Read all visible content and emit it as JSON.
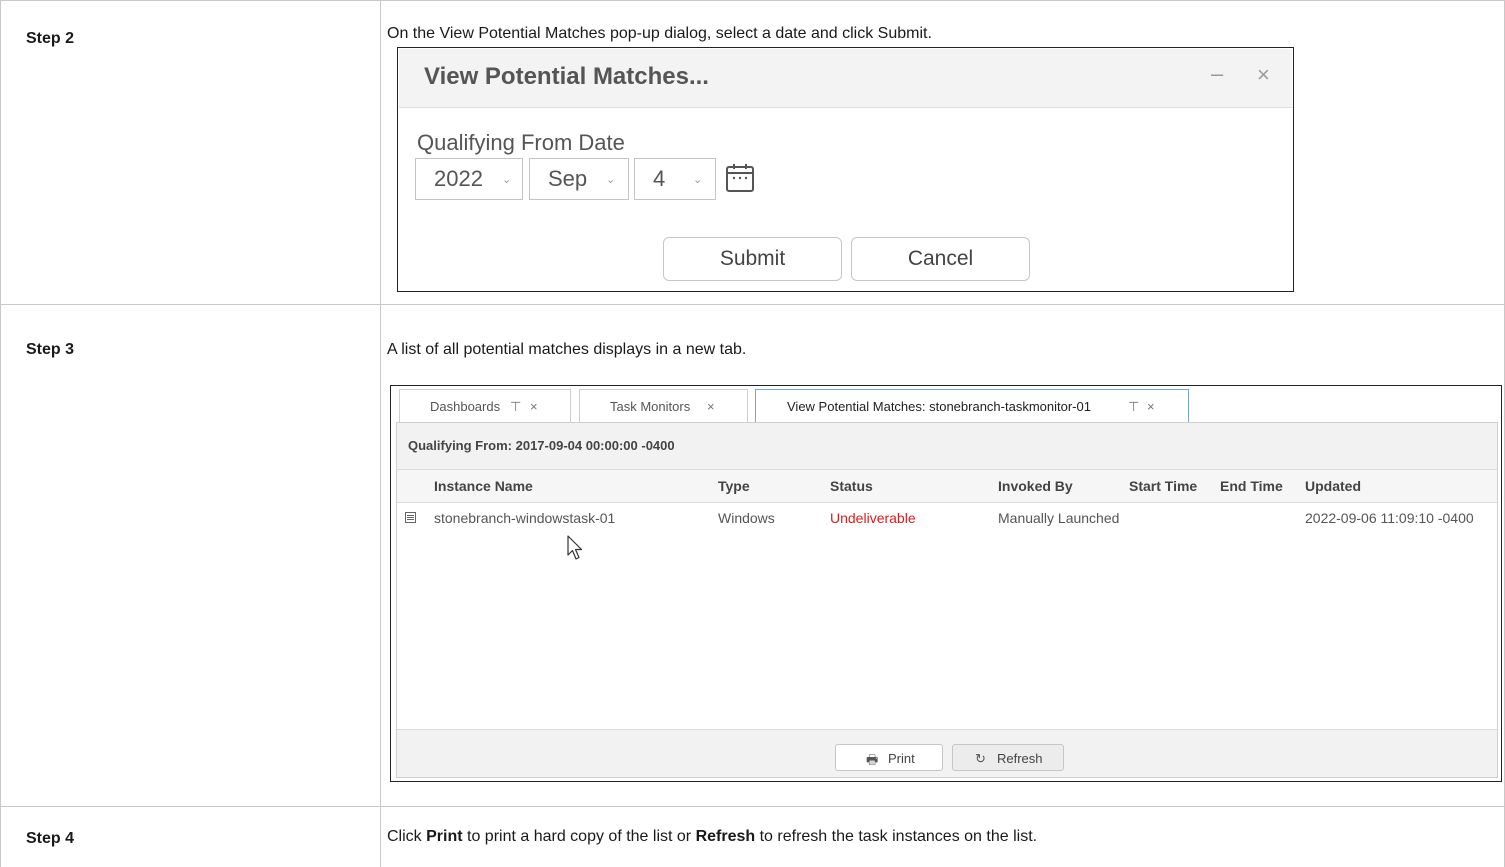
{
  "steps": [
    {
      "label": "Step 2",
      "text": "On the View Potential Matches pop-up dialog, select a date and click Submit."
    },
    {
      "label": "Step 3",
      "text": "A list of all potential matches displays in a new tab."
    },
    {
      "label": "Step 4",
      "text_parts": [
        "Click ",
        "Print",
        " to print a hard copy of the list or ",
        "Refresh",
        " to refresh the task instances on the list."
      ]
    }
  ],
  "dialog": {
    "title": "View Potential Matches...",
    "minimize": "–",
    "close": "×",
    "field_label": "Qualifying From Date",
    "year": "2022",
    "month": "Sep",
    "day": "4",
    "submit": "Submit",
    "cancel": "Cancel"
  },
  "tabs": [
    {
      "label": "Dashboards",
      "pin": "⊤",
      "close": "×"
    },
    {
      "label": "Task Monitors",
      "close": "×"
    },
    {
      "label": "View Potential Matches: stonebranch-taskmonitor-01",
      "pin": "⊤",
      "close": "×"
    }
  ],
  "list": {
    "qualifying": "Qualifying From: 2017-09-04 00:00:00 -0400",
    "columns": [
      "Instance Name",
      "Type",
      "Status",
      "Invoked By",
      "Start Time",
      "End Time",
      "Updated"
    ],
    "rows": [
      {
        "name": "stonebranch-windowstask-01",
        "type": "Windows",
        "status": "Undeliverable",
        "invoked_by": "Manually Launched",
        "start": "",
        "end": "",
        "updated": "2022-09-06 11:09:10 -0400"
      }
    ],
    "status_color": "#d81e1e",
    "print": "Print",
    "refresh": "Refresh",
    "print_icon": "printer-icon",
    "refresh_icon": "refresh-icon"
  }
}
